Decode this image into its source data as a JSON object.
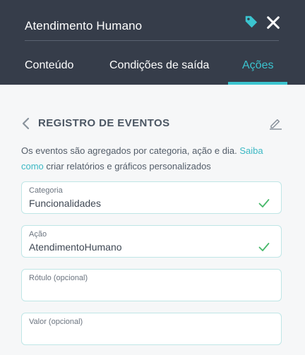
{
  "header": {
    "title": "Atendimento Humano",
    "icons": {
      "tag": "tag-icon",
      "close": "close-icon"
    }
  },
  "tabs": [
    {
      "label": "Conteúdo",
      "active": false
    },
    {
      "label": "Condições de saída",
      "active": false
    },
    {
      "label": "Ações",
      "active": true
    }
  ],
  "section": {
    "title": "REGISTRO DE EVENTOS",
    "description_before": "Os eventos são agregados por categoria, ação e dia. ",
    "link_text": "Saiba como",
    "description_after": " criar relatórios e gráficos personalizados"
  },
  "fields": [
    {
      "label": "Categoria",
      "value": "Funcionalidades",
      "valid": true
    },
    {
      "label": "Ação",
      "value": "AtendimentoHumano",
      "valid": true
    },
    {
      "label": "Rótulo (opcional)",
      "value": "",
      "valid": false
    },
    {
      "label": "Valor (opcional)",
      "value": "",
      "valid": false
    }
  ],
  "colors": {
    "header_bg": "#363d4a",
    "accent": "#3bc4cf",
    "field_border": "#bfe6e6",
    "check": "#47b86a",
    "page_bg": "#f6f7f8"
  }
}
